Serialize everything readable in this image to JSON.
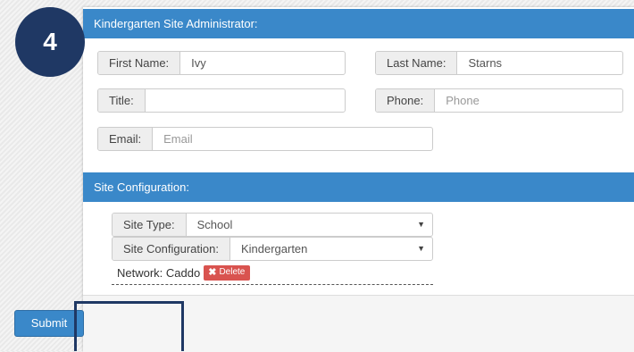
{
  "step_badge": "4",
  "admin_section": {
    "header": "Kindergarten Site Administrator:",
    "first_name": {
      "label": "First Name:",
      "value": "Ivy"
    },
    "last_name": {
      "label": "Last Name:",
      "value": "Starns"
    },
    "title": {
      "label": "Title:",
      "value": "",
      "placeholder": ""
    },
    "phone": {
      "label": "Phone:",
      "value": "",
      "placeholder": "Phone"
    },
    "email": {
      "label": "Email:",
      "value": "",
      "placeholder": "Email"
    }
  },
  "site_config": {
    "header": "Site Configuration:",
    "site_type": {
      "label": "Site Type:",
      "selected": "School"
    },
    "site_configuration": {
      "label": "Site Configuration:",
      "selected": "Kindergarten"
    },
    "network_label": "Network: Caddo",
    "delete_label": "Delete"
  },
  "footer": {
    "submit_label": "Submit"
  },
  "colors": {
    "header_blue": "#3a88c9",
    "badge_navy": "#1f3864",
    "delete_red": "#d9534f"
  }
}
